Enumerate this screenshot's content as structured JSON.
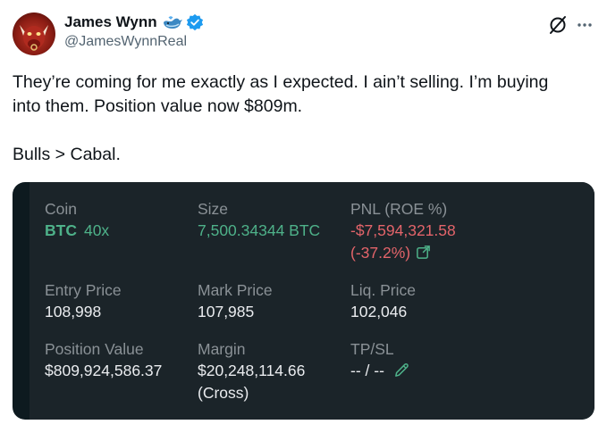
{
  "author": {
    "name": "James Wynn",
    "handle": "@JamesWynnReal"
  },
  "tweet": {
    "line1": "They’re coming for me exactly as I expected. I ain’t selling. I’m buying",
    "line2": "into them. Position value now $809m.",
    "line3": "Bulls > Cabal."
  },
  "position": {
    "coin_label": "Coin",
    "coin": "BTC",
    "leverage": "40x",
    "size_label": "Size",
    "size": "7,500.34344 BTC",
    "pnl_label": "PNL (ROE %)",
    "pnl": "-$7,594,321.58",
    "roe": "(-37.2%)",
    "entry_label": "Entry Price",
    "entry": "108,998",
    "mark_label": "Mark Price",
    "mark": "107,985",
    "liq_label": "Liq. Price",
    "liq": "102,046",
    "value_label": "Position Value",
    "value": "$809,924,586.37",
    "margin_label": "Margin",
    "margin": "$20,248,114.66",
    "margin_mode": "(Cross)",
    "tpsl_label": "TP/SL",
    "tpsl": "-- / --"
  },
  "colors": {
    "positive": "#4eb189",
    "negative": "#e3646a",
    "verified": "#1d9bf0"
  },
  "icons": [
    "avatar",
    "whale-icon",
    "verified-badge-icon",
    "grok-icon",
    "more-icon",
    "external-link-icon",
    "pencil-icon"
  ]
}
